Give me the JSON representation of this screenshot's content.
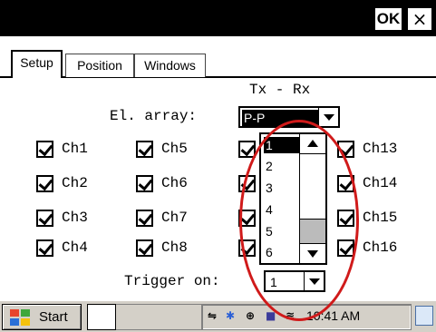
{
  "titlebar": {
    "ok_label": "OK",
    "close_label": "×"
  },
  "tabs": [
    {
      "label": "Setup",
      "active": true
    },
    {
      "label": "Position",
      "active": false
    },
    {
      "label": "Windows",
      "active": false
    }
  ],
  "header": {
    "txrx": "Tx - Rx"
  },
  "el_array": {
    "label": "El. array:",
    "value": "P-P"
  },
  "channels": {
    "col1": [
      "Ch1",
      "Ch2",
      "Ch3",
      "Ch4"
    ],
    "col2": [
      "Ch5",
      "Ch6",
      "Ch7",
      "Ch8"
    ],
    "col4": [
      "Ch13",
      "Ch14",
      "Ch15",
      "Ch16"
    ]
  },
  "dropdown": {
    "options": [
      "1",
      "2",
      "3",
      "4",
      "5",
      "6"
    ],
    "selected": "1"
  },
  "trigger": {
    "label": "Trigger on:",
    "value": "1"
  },
  "taskbar": {
    "start_label": "Start",
    "clock": "10:41 AM"
  },
  "colors": {
    "annotation": "#d01a1a",
    "titlebar": "#000000",
    "taskbar": "#d4d0c8"
  }
}
